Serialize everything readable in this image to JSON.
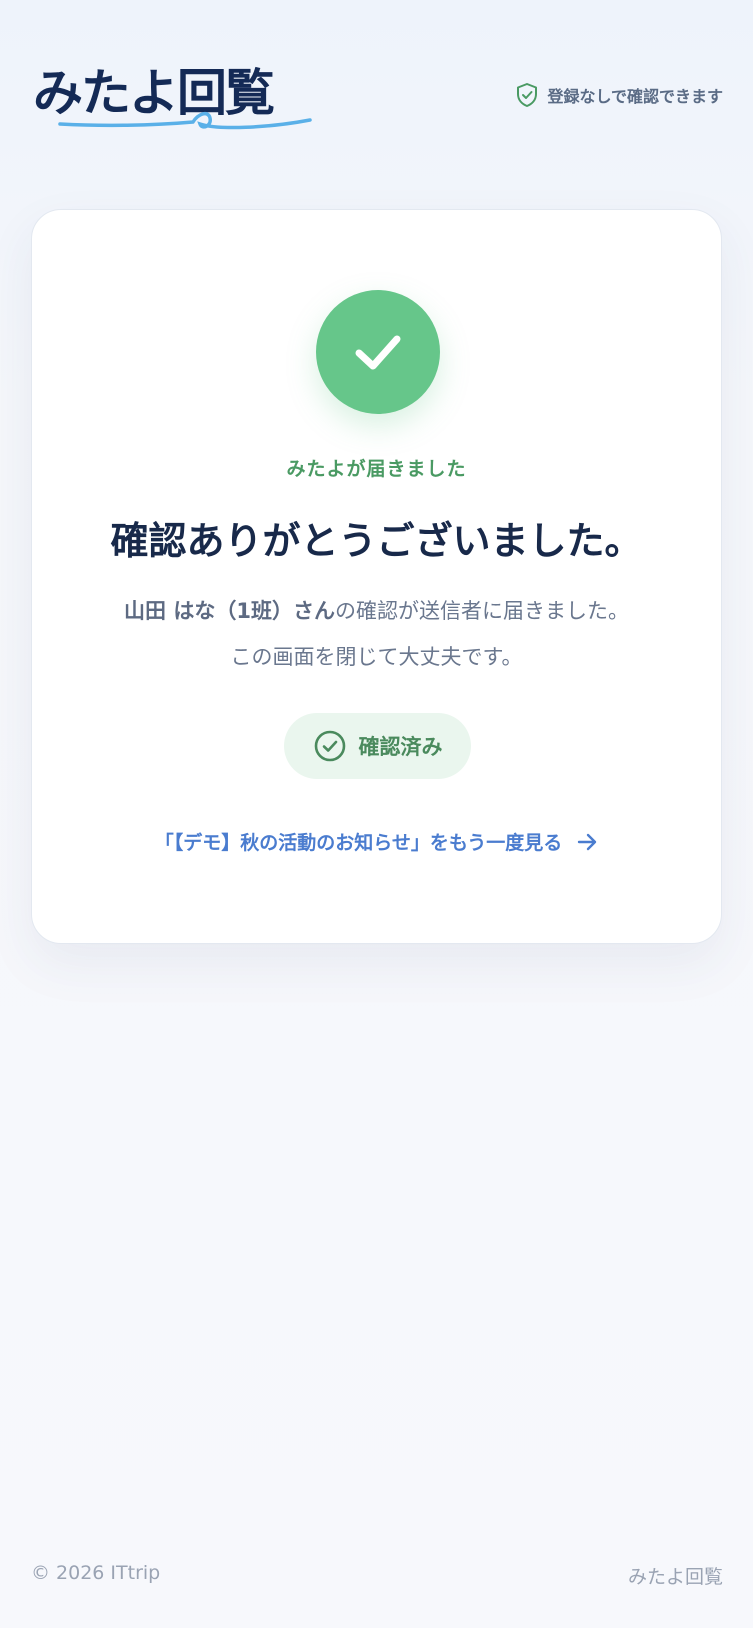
{
  "header": {
    "logo_text": "みたよ回覧",
    "note": "登録なしで確認できます"
  },
  "card": {
    "eyebrow": "みたよが届きました",
    "title": "確認ありがとうございました。",
    "message": {
      "name": "山田 はな（1班）さん",
      "line1_rest": "の確認が送信者に届きました。",
      "line2": "この画面を閉じて大丈夫です。"
    },
    "badge_label": "確認済み",
    "again_link": "「【デモ】秋の活動のお知らせ」をもう一度見る"
  },
  "footer": {
    "copyright": "© 2026 ITtrip",
    "brand": "みたよ回覧"
  },
  "colors": {
    "accent_green": "#66c68a",
    "navy": "#142a56",
    "link_blue": "#4a7ccf"
  },
  "icons": [
    "shield-check-icon",
    "check-icon",
    "check-circle-icon",
    "arrow-right-icon"
  ]
}
